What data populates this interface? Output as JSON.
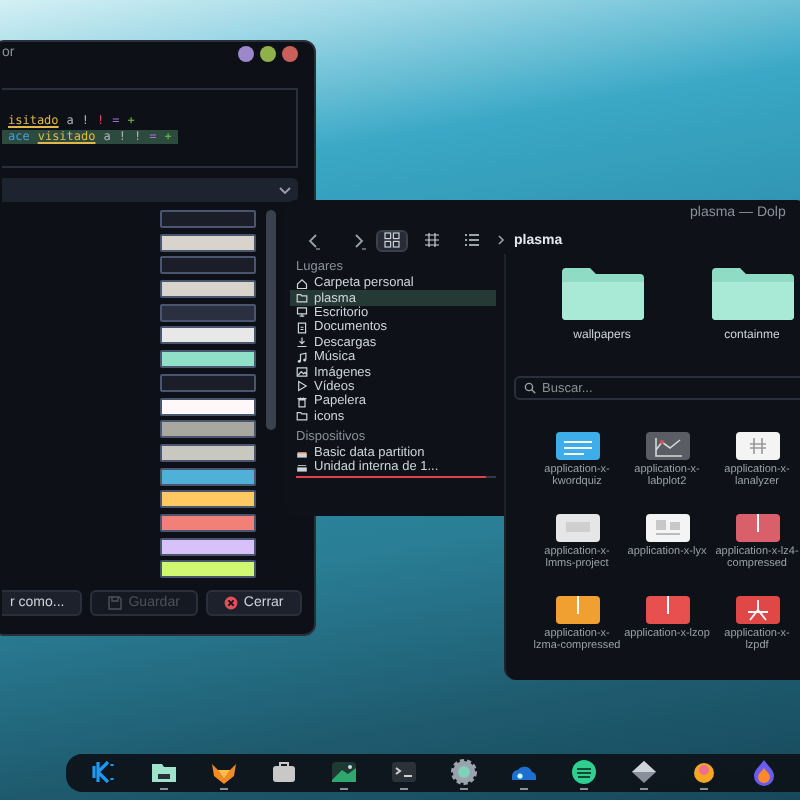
{
  "editor": {
    "title": "or",
    "title_buttons": [
      {
        "color": "#9b87c9"
      },
      {
        "color": "#8fb04a"
      },
      {
        "color": "#c9605a"
      }
    ],
    "code_lines": [
      {
        "highlighted": false,
        "tokens": [
          {
            "text": "isitado",
            "kind": "link"
          },
          {
            "text": "a",
            "kind": "text"
          },
          {
            "text": "!",
            "kind": "text"
          },
          {
            "text": "!",
            "kind": "error"
          },
          {
            "text": "=",
            "kind": "operator"
          },
          {
            "text": "+",
            "kind": "addition"
          }
        ]
      },
      {
        "highlighted": true,
        "tokens": [
          {
            "text": "ace",
            "kind": "type"
          },
          {
            "text": "visitado",
            "kind": "link"
          },
          {
            "text": "a",
            "kind": "text"
          },
          {
            "text": "!",
            "kind": "text"
          },
          {
            "text": "!",
            "kind": "text"
          },
          {
            "text": "=",
            "kind": "operator"
          },
          {
            "text": "+",
            "kind": "addition"
          }
        ]
      }
    ],
    "swatches": [
      {
        "color": "#1b1e28"
      },
      {
        "color": "#d8d4cc"
      },
      {
        "color": "#1b1e28"
      },
      {
        "color": "#d8d4cc"
      },
      {
        "color": "#2a3040"
      },
      {
        "color": "#e8e8e8"
      },
      {
        "color": "#90e0c8"
      },
      {
        "color": "#1b1e28"
      },
      {
        "color": "#fff8f8"
      },
      {
        "color": "#a8a8a0"
      },
      {
        "color": "#c8c8c0"
      },
      {
        "color": "#50b0d8"
      },
      {
        "color": "#ffc860"
      },
      {
        "color": "#f08078"
      },
      {
        "color": "#d8c0f8"
      },
      {
        "color": "#d0f870"
      }
    ],
    "buttons": [
      {
        "label": "r como...",
        "kind": "plain",
        "disabled": false
      },
      {
        "label": "Guardar",
        "kind": "save",
        "disabled": true
      },
      {
        "label": "Cerrar",
        "kind": "close",
        "disabled": false
      }
    ]
  },
  "dolphin": {
    "title": "plasma — Dolp",
    "breadcrumb": "plasma",
    "view_modes": [
      {
        "kind": "icons",
        "selected": true
      },
      {
        "kind": "compact",
        "selected": false
      },
      {
        "kind": "details",
        "selected": false
      }
    ],
    "sidebar": [
      {
        "heading": "Lugares",
        "items": [
          {
            "label": "Carpeta personal",
            "kind": "home",
            "selected": false
          },
          {
            "label": "plasma",
            "kind": "folder",
            "selected": true
          },
          {
            "label": "Escritorio",
            "kind": "monitor",
            "selected": false
          },
          {
            "label": "Documentos",
            "kind": "document",
            "selected": false
          },
          {
            "label": "Descargas",
            "kind": "download",
            "selected": false
          },
          {
            "label": "Música",
            "kind": "music",
            "selected": false
          },
          {
            "label": "Imágenes",
            "kind": "image",
            "selected": false
          },
          {
            "label": "Vídeos",
            "kind": "video",
            "selected": false
          },
          {
            "label": "Papelera",
            "kind": "trash",
            "selected": false
          },
          {
            "label": "icons",
            "kind": "folder",
            "selected": false
          }
        ]
      },
      {
        "heading": "Dispositivos",
        "items": [
          {
            "label": "Basic data partition",
            "kind": "drive-active",
            "selected": false
          },
          {
            "label": "Unidad interna de 1...",
            "kind": "drive",
            "selected": false,
            "level": 0.95
          }
        ]
      }
    ],
    "folders": [
      {
        "name": "wallpapers"
      },
      {
        "name": "containme"
      }
    ],
    "search": {
      "placeholder": "Buscar..."
    },
    "files": [
      {
        "name": "application-x-kwordquiz",
        "kind": "document",
        "color": "#3daee9"
      },
      {
        "name": "application-x-labplot2",
        "kind": "chart",
        "color": "#5a5d63"
      },
      {
        "name": "application-x-lanalyzer",
        "kind": "grid",
        "color": "#f4f4f4"
      },
      {
        "name": "application-x-lmms-project",
        "kind": "blank",
        "color": "#e6e6e6"
      },
      {
        "name": "application-x-lyx",
        "kind": "text-image",
        "color": "#f4f4f4"
      },
      {
        "name": "application-x-lz4-compressed",
        "kind": "zip",
        "color": "#d9606a"
      },
      {
        "name": "application-x-lzma-compressed",
        "kind": "zip",
        "color": "#f0a030"
      },
      {
        "name": "application-x-lzop",
        "kind": "zip",
        "color": "#e85050"
      },
      {
        "name": "application-x-lzpdf",
        "kind": "pdf",
        "color": "#e04848"
      }
    ]
  },
  "taskbar": {
    "items": [
      {
        "kind": "k-logo",
        "running": false
      },
      {
        "kind": "folder",
        "running": true
      },
      {
        "kind": "fox",
        "running": true
      },
      {
        "kind": "bag",
        "running": false
      },
      {
        "kind": "image",
        "running": true
      },
      {
        "kind": "terminal",
        "running": true
      },
      {
        "kind": "gear",
        "running": true
      },
      {
        "kind": "cloud",
        "running": true
      },
      {
        "kind": "stripes",
        "running": true
      },
      {
        "kind": "diamond",
        "running": true
      },
      {
        "kind": "flower",
        "running": true
      },
      {
        "kind": "flame",
        "running": false
      }
    ]
  }
}
